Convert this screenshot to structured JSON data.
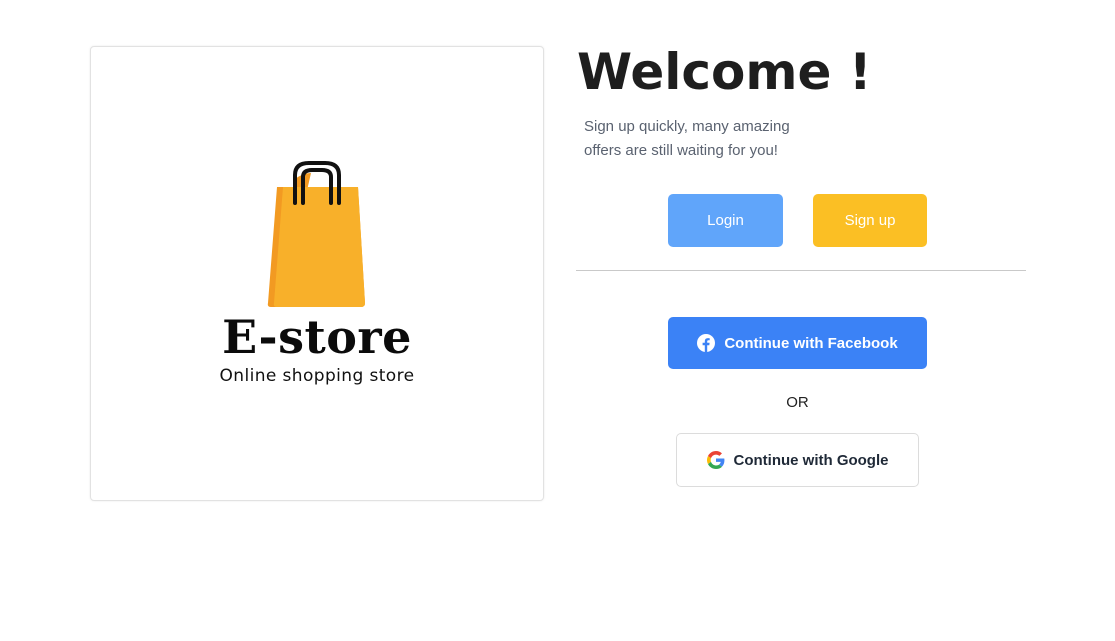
{
  "brand": {
    "name": "E-store",
    "tagline": "Online shopping store"
  },
  "welcome": {
    "title": "Welcome !",
    "subtitle": "Sign up quickly, many amazing offers are still waiting for you!"
  },
  "auth": {
    "login_label": "Login",
    "signup_label": "Sign up",
    "facebook_label": "Continue with Facebook",
    "or_label": "OR",
    "google_label": "Continue with Google"
  },
  "icons": {
    "bag": "shopping-bag-icon",
    "facebook": "facebook-icon",
    "google": "google-icon"
  },
  "colors": {
    "login_button": "#60a5fa",
    "signup_button": "#fbbf24",
    "facebook_button": "#3b82f6",
    "bag_body": "#f8b02a",
    "bag_side": "#f29a22"
  }
}
